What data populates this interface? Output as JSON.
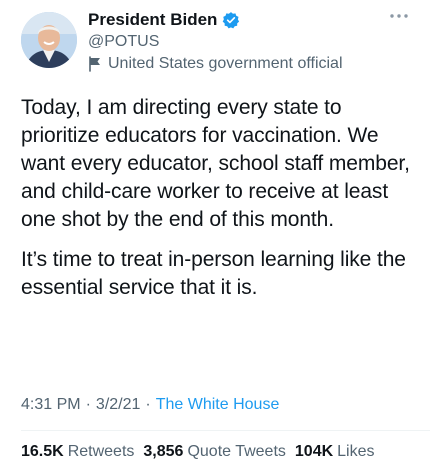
{
  "author": {
    "display_name": "President Biden",
    "handle": "@POTUS",
    "label": "United States government official"
  },
  "tweet": {
    "paragraph_1": "Today, I am directing every state to prioritize educators for vaccination. We want every educator, school staff member, and child-care worker to receive at least one shot by the end of this month.",
    "paragraph_2": "It’s time to treat in-person learning like the essential service that it is."
  },
  "meta": {
    "time": "4:31 PM",
    "separator": "·",
    "date": "3/2/21",
    "source": "The White House"
  },
  "stats": {
    "retweets": {
      "count": "16.5K",
      "label": "Retweets"
    },
    "quote_tweets": {
      "count": "3,856",
      "label": "Quote Tweets"
    },
    "likes": {
      "count": "104K",
      "label": "Likes"
    }
  },
  "colors": {
    "accent": "#1d9bf0",
    "secondary_text": "#536471",
    "primary_text": "#0f1419"
  }
}
